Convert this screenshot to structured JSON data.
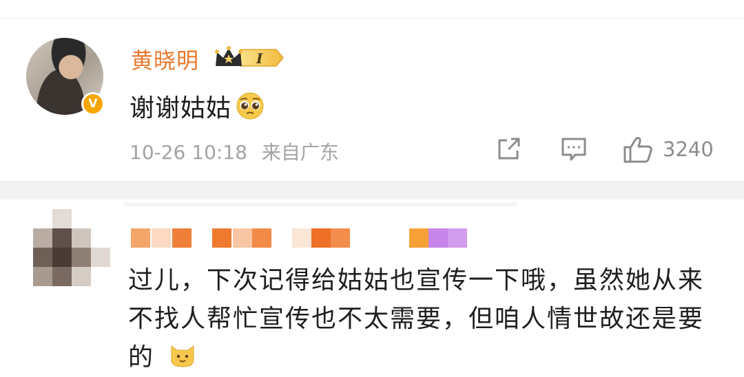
{
  "comment1": {
    "username": "黄晓明",
    "vip_level": "I",
    "verified_badge": "V",
    "text": "谢谢姑姑",
    "emoji": "pleading-face",
    "date": "10-26 10:18",
    "location": "来自广东",
    "like_count": "3240"
  },
  "comment2": {
    "text": "过儿，下次记得给姑姑也宣传一下哦，虽然她从来不找人帮忙宣传也不太需要，但咱人情世故还是要的",
    "emoji": "cat-face"
  },
  "colors": {
    "username": "#e8782c",
    "meta_text": "#a3a3a3",
    "separator": "#f2f2f2",
    "verified": "#f7a600"
  },
  "icons": [
    "share-icon",
    "comment-icon",
    "like-icon",
    "vip-crown-icon"
  ]
}
